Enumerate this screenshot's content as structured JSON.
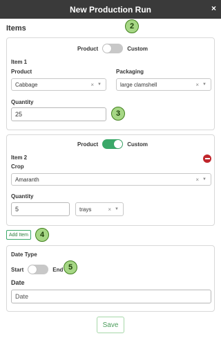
{
  "dialog": {
    "title": "New Production Run",
    "close": "×"
  },
  "items_heading": "Items",
  "badges": {
    "b2": "2",
    "b3": "3",
    "b4": "4",
    "b5": "5"
  },
  "item1": {
    "toggle_left": "Product",
    "toggle_right": "Custom",
    "toggle_on": false,
    "heading": "Item 1",
    "product_label": "Product",
    "product_value": "Cabbage",
    "packaging_label": "Packaging",
    "packaging_value": "large clamshell",
    "quantity_label": "Quantity",
    "quantity_value": "25"
  },
  "item2": {
    "toggle_left": "Product",
    "toggle_right": "Custom",
    "toggle_on": true,
    "heading": "Item 2",
    "crop_label": "Crop",
    "crop_value": "Amaranth",
    "quantity_label": "Quantity",
    "quantity_value": "5",
    "unit_value": "trays"
  },
  "add_item_label": "Add Item",
  "date_section": {
    "heading": "Date Type",
    "toggle_left": "Start",
    "toggle_right": "End",
    "toggle_on": false,
    "date_label": "Date",
    "date_placeholder": "Date"
  },
  "save_label": "Save",
  "colors": {
    "title_bg": "#3a3a3a",
    "toggle_on": "#3aa868",
    "toggle_off": "#c8c8c8",
    "remove": "#c0262c",
    "badge_fill": "#a6d785"
  },
  "icons": {
    "close": "close-icon",
    "clear": "clear-icon",
    "caret": "chevron-down-icon",
    "remove": "remove-circle-icon"
  }
}
